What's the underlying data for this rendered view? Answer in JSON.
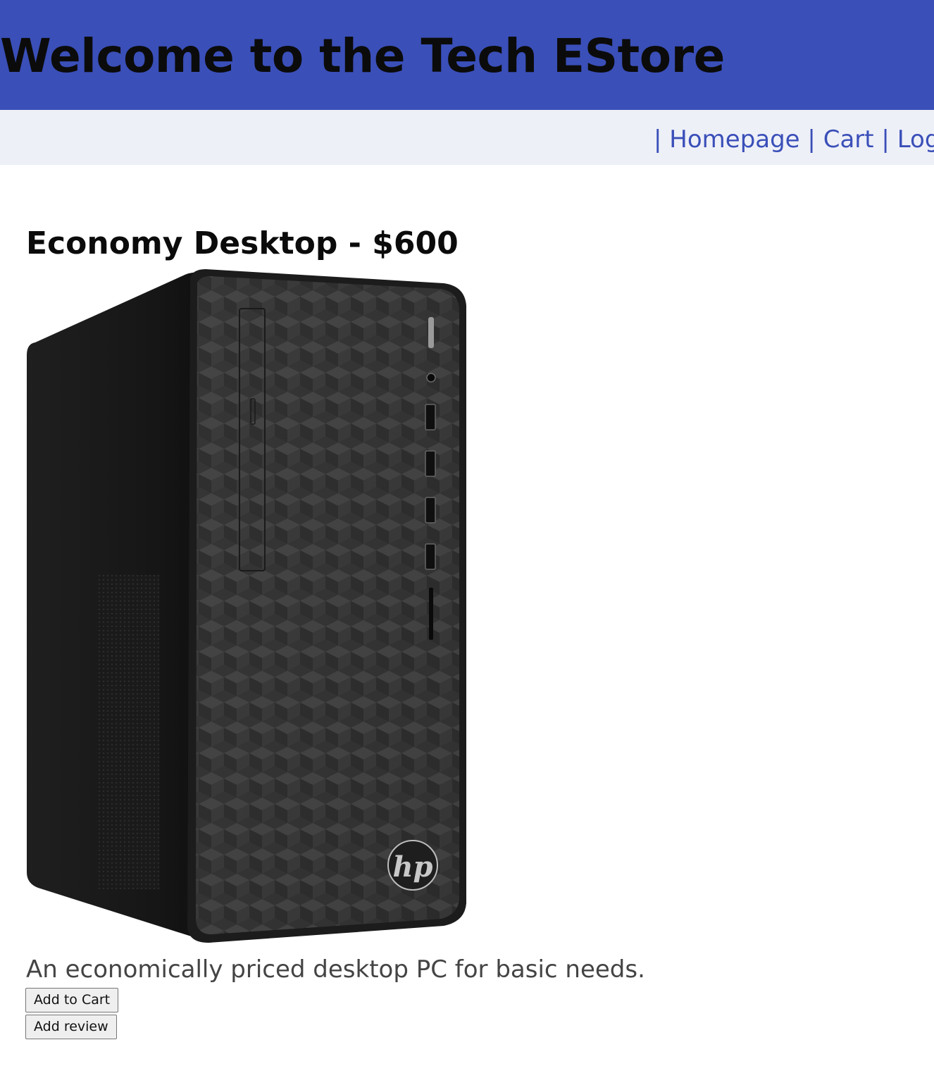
{
  "header": {
    "title": "Welcome to the Tech EStore",
    "background_color": "#3a4fb8"
  },
  "nav": {
    "separator": "|",
    "links": [
      {
        "label": "Homepage"
      },
      {
        "label": "Cart"
      },
      {
        "label": "Login"
      }
    ],
    "link_color": "#3a4fb8",
    "background_color": "#eef0f8"
  },
  "product": {
    "title": "Economy Desktop - $600",
    "image": {
      "icon": "desktop-tower-image",
      "brand_logo": "hp"
    },
    "description": "An economically priced desktop PC for basic needs.",
    "add_to_cart_label": "Add to Cart",
    "add_review_label": "Add review"
  }
}
